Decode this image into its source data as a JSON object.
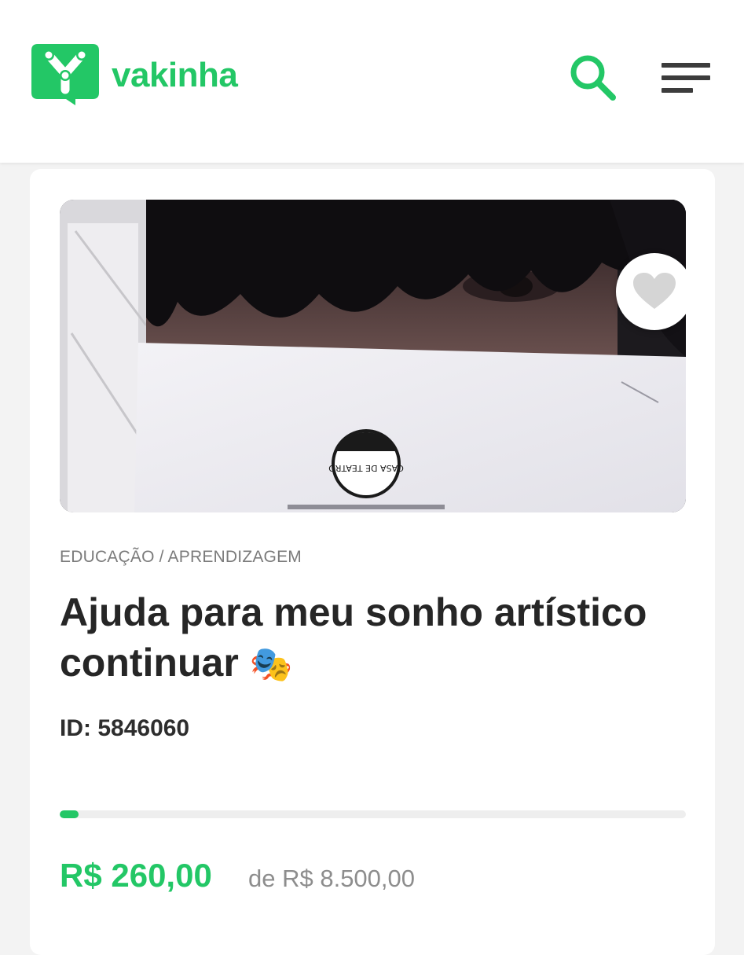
{
  "header": {
    "brand_name": "vakinha",
    "brand_color": "#23c766",
    "search_icon": "search-icon",
    "menu_icon": "hamburger-menu-icon"
  },
  "campaign": {
    "category": "EDUCAÇÃO / APRENDIZAGEM",
    "title": "Ajuda para meu sonho artístico continuar",
    "title_emoji": "🎭",
    "id_text": "ID: 5846060",
    "raised": "R$ 260,00",
    "goal": "de R$ 8.500,00",
    "progress_fraction": 0.0306,
    "favorite_icon": "heart-icon",
    "image_stamp_text": "CASA DE TEATRO"
  }
}
